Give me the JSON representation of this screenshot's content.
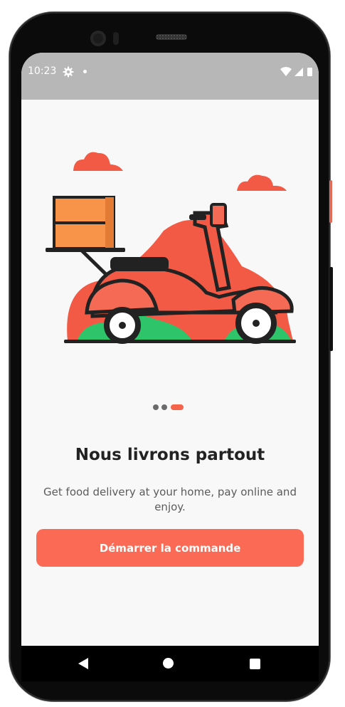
{
  "status_bar": {
    "time": "10:23",
    "icons": [
      "settings-icon",
      "notification-dot-icon",
      "wifi-icon",
      "signal-icon",
      "battery-icon"
    ]
  },
  "onboarding": {
    "title": "Nous livrons partout",
    "subtitle": "Get food delivery at your home, pay online and enjoy.",
    "page_indicator": {
      "total": 3,
      "current": 3
    },
    "cta_label": "Démarrer la commande"
  },
  "colors": {
    "accent": "#fb6a55",
    "scooter": "#f25a45",
    "box": "#f7944a",
    "grass": "#2ec46a",
    "statusbar": "#b7b7b7"
  },
  "navigation_bar": {
    "icons": [
      "back-icon",
      "home-icon",
      "recents-icon"
    ]
  }
}
